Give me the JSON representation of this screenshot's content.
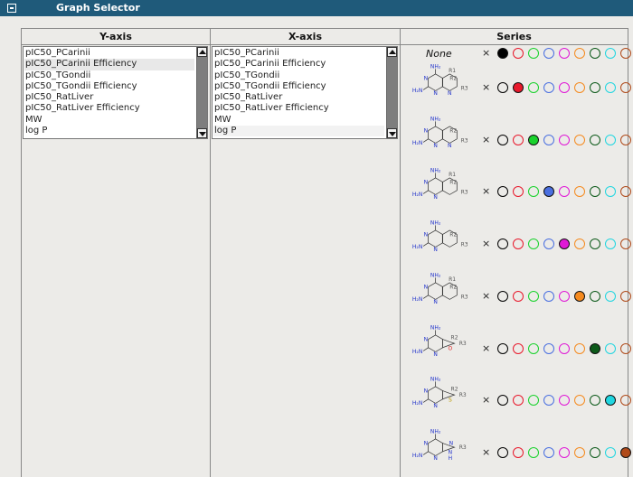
{
  "panel": {
    "title": "Graph Selector"
  },
  "columns": {
    "y_axis": "Y-axis",
    "x_axis": "X-axis",
    "series": "Series"
  },
  "y_list": {
    "items": [
      "pIC50_PCarinii",
      "pIC50_PCarinii Efficiency",
      "pIC50_TGondii",
      "pIC50_TGondii Efficiency",
      "pIC50_RatLiver",
      "pIC50_RatLiver Efficiency",
      "MW",
      "log P"
    ],
    "highlighted": "pIC50_PCarinii Efficiency"
  },
  "x_list": {
    "items": [
      "pIC50_PCarinii",
      "pIC50_PCarinii Efficiency",
      "pIC50_TGondii",
      "pIC50_TGondii Efficiency",
      "pIC50_RatLiver",
      "pIC50_RatLiver Efficiency",
      "MW",
      "log P"
    ],
    "selected": "log P"
  },
  "series": {
    "none_label": "None",
    "remove_glyph": "×",
    "palette": [
      "#000000",
      "#e8192c",
      "#19d22c",
      "#4a6fe0",
      "#e019d6",
      "#f58a1e",
      "#0d5a1a",
      "#20d6e0",
      "#b04a1a"
    ],
    "rows": [
      {
        "structure": "none",
        "selected_index": 0
      },
      {
        "structure": "pyrido-pyrimidine-R1R2R3",
        "selected_index": 1
      },
      {
        "structure": "pyrido-pyrimidine-R2R3",
        "selected_index": 2
      },
      {
        "structure": "quinazoline-R1R2R3",
        "selected_index": 3
      },
      {
        "structure": "quinazoline-R2R3",
        "selected_index": 4
      },
      {
        "structure": "tetrahydroquinazoline-R1R2R3",
        "selected_index": 5
      },
      {
        "structure": "furo-pyrimidine-R2R3",
        "selected_index": 6
      },
      {
        "structure": "thieno-pyrimidine-R2R3",
        "selected_index": 7
      },
      {
        "structure": "purine-R3",
        "selected_index": 8
      }
    ],
    "mol_labels": {
      "nh2": "NH₂",
      "h2n": "H₂N",
      "n": "N",
      "o": "O",
      "s": "S",
      "h": "H",
      "r1": "R1",
      "r2": "R2",
      "r3": "R3"
    }
  }
}
